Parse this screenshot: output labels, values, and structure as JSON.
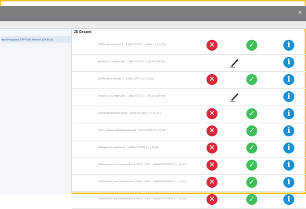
{
  "window": {
    "close_label": "×"
  },
  "sidebar": {
    "items": [
      {
        "label": "ntpc/Fang bad DPR IDB Jnbenw (DKfR-A)"
      }
    ]
  },
  "main": {
    "count_label": "28 Gesamt",
    "rows": [
      {
        "label": "DPRindlich Rendel 1 · 1068 ITZITT | · 1068A | L | S| 28 |",
        "state": "ok"
      },
      {
        "label": "Rivich LiG Gdfsa+Allb · 1068 ITZITT | L | S| 28 ADF bel",
        "state": "pen"
      },
      {
        "label": "DPRindlich Rendel 2 · 1068 ITZITT | L | S| 28 |",
        "state": "ok"
      },
      {
        "label": "Rivich LiG Gdfsa+Allb · 1068 ITZITT | L | S| 19 ADF bel",
        "state": "pen"
      },
      {
        "label": "Gemeinkostenrechnung · 1068 IGI 2INT | L | S| 28 |",
        "state": "ok"
      },
      {
        "label": "SHV 1 Dikorrnagsforbersitnung · DKFTV09A HT | 8| 28 |",
        "state": "ok"
      },
      {
        "label": "Obergaburungsefenzt · 1068M ITZ8PE | L | S| 28 |",
        "state": "ok"
      },
      {
        "label": "Strkfahrsch und Kuswehrflus 3 ISKA - 8.8K · 1068IGETITERE | L | S| 19 |",
        "state": "ok"
      },
      {
        "label": "Strkfahrsch und Kuswehrflus 3 ISKA - 8.8K · 1068IGETITERE | L | S| 19 |",
        "state": "ok"
      },
      {
        "label": "Strkfahrsch und Kuswehrflus 3 ISKA - 8.8K · 1068IGETITERE | L | S| 19 |",
        "state": "ok"
      }
    ]
  },
  "icons": {
    "x": "x-icon",
    "check": "check-icon",
    "info": "info-icon",
    "pen": "pen-icon"
  },
  "colors": {
    "frame": "#f2c21b",
    "titlebar": "#7b7d80",
    "x": "#d9283a",
    "check": "#3fbf5a",
    "info": "#1a8fd8"
  }
}
